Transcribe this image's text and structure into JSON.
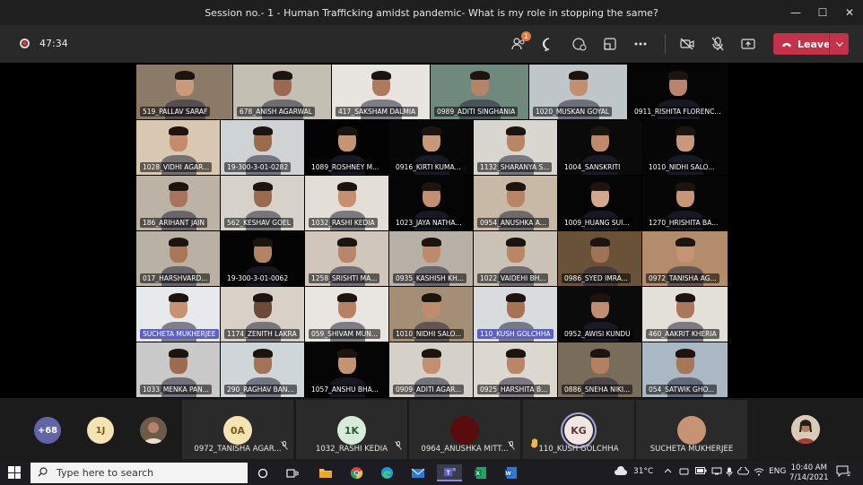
{
  "window": {
    "title": "Session no.- 1 - Human Trafficking amidst pandemic- What is my role in stopping the same?",
    "minimize": "—",
    "maximize": "☐",
    "close": "✕"
  },
  "toolbar": {
    "timer": "47:34",
    "participants_badge": "1",
    "leave_label": "Leave"
  },
  "grid": {
    "tiles": [
      {
        "name": "519_PALLAV SARAF",
        "bg": "#8c7a68",
        "face": "#c99a7a"
      },
      {
        "name": "678_ANISH AGARWAL",
        "bg": "#c4bfb3",
        "face": "#9b6a4e"
      },
      {
        "name": "417_SAKSHAM DALMIA",
        "bg": "#e8e5e0",
        "face": "#b07b5c"
      },
      {
        "name": "0989_ADITI SINGHANIA",
        "bg": "#6f8a7c",
        "face": "#b58468"
      },
      {
        "name": "1020_MUSKAN GOYAL",
        "bg": "#bfc6c9",
        "face": "#c28f70"
      },
      {
        "name": "0911_RISHITA FLORENC...",
        "bg": "#050505",
        "face": "#b9846a"
      },
      {
        "name": "1028_VIDHI AGAR...",
        "bg": "#d8c8b2",
        "face": "#c48c6c"
      },
      {
        "name": "19-300-3-01-0282",
        "bg": "#cfd3d6",
        "face": "#9d6b4c"
      },
      {
        "name": "1089_ROSHNEY M...",
        "bg": "#030303",
        "face": "#c69473"
      },
      {
        "name": "0916_KIRTI KUMA...",
        "bg": "#070707",
        "face": "#c9977a"
      },
      {
        "name": "1132_SHARANYA S...",
        "bg": "#d9d6d0",
        "face": "#b98565"
      },
      {
        "name": "1004_SANSKRITI",
        "bg": "#0a0a0a",
        "face": "#bf8b6b"
      },
      {
        "name": "1010_NIDHI SALO...",
        "bg": "#060606",
        "face": "#c99879"
      },
      {
        "name": "186_ARIHANT JAIN",
        "bg": "#bcb2a5",
        "face": "#a8755a"
      },
      {
        "name": "562_KESHAV GOEL",
        "bg": "#d6d2ca",
        "face": "#9c6b4f"
      },
      {
        "name": "1032_RASHI KEDIA",
        "bg": "#e3ded6",
        "face": "#c49070"
      },
      {
        "name": "1023_JAYA NATHA...",
        "bg": "#050505",
        "face": "#c38f70"
      },
      {
        "name": "0954_ANUSHKA A...",
        "bg": "#c7b9a6",
        "face": "#b88464"
      },
      {
        "name": "1009_HUANG SUI...",
        "bg": "#050505",
        "face": "#d3a98c"
      },
      {
        "name": "1270_HRISHITA BA...",
        "bg": "#060606",
        "face": "#c69676"
      },
      {
        "name": "017_HARSHVARD...",
        "bg": "#b9b1a4",
        "face": "#a97658"
      },
      {
        "name": "19-300-3-01-0062",
        "bg": "#040404",
        "face": "#b48364"
      },
      {
        "name": "1258_SRISHTI MA...",
        "bg": "#d0c6bb",
        "face": "#b8866a"
      },
      {
        "name": "0935_KASHISH KH...",
        "bg": "#b7b0a6",
        "face": "#bd8a6a"
      },
      {
        "name": "1022_VAIDEHI BH...",
        "bg": "#cac2b6",
        "face": "#b98666"
      },
      {
        "name": "0986_SYED IMRA...",
        "bg": "#6a5238",
        "face": "#a17356"
      },
      {
        "name": "0972_TANISHA AG...",
        "bg": "#b38c6c",
        "face": "#c49474"
      },
      {
        "name": "SUCHETA MUKHERJEE",
        "bg": "#e7e9ec",
        "face": "#c69474"
      },
      {
        "name": "1174_ZENITH LAKRA",
        "bg": "#d8d1c7",
        "face": "#6b4a38"
      },
      {
        "name": "059_SHIVAM MUN...",
        "bg": "#e9e6e1",
        "face": "#b78163"
      },
      {
        "name": "1010_NIDHI SALO...",
        "bg": "#a48f76",
        "face": "#bf8c6d"
      },
      {
        "name": "110_KUSH GOLCHHA",
        "bg": "#d9dcdf",
        "face": "#a67455"
      },
      {
        "name": "0952_AWISI KUNDU",
        "bg": "#0b0b0b",
        "face": "#c08e6f"
      },
      {
        "name": "460_AAKRIT KHERIA",
        "bg": "#e3dfd9",
        "face": "#a9785b"
      },
      {
        "name": "1033_MENKA PAN...",
        "bg": "#c9c9c9",
        "face": "#9d6c50"
      },
      {
        "name": "290_RAGHAV BAN...",
        "bg": "#cfd6d9",
        "face": "#a47257"
      },
      {
        "name": "1057_ANSHU BHA...",
        "bg": "#050505",
        "face": "#c49373"
      },
      {
        "name": "0909_ADITI AGAR...",
        "bg": "#d5d0c8",
        "face": "#c28f70"
      },
      {
        "name": "0925_HARSHITA B...",
        "bg": "#ddd8cf",
        "face": "#b98667"
      },
      {
        "name": "0886_SNEHA NIKI...",
        "bg": "#7a6c5a",
        "face": "#b38062"
      },
      {
        "name": "054_SATWIK GHO...",
        "bg": "#a9b8c4",
        "face": "#a87759"
      }
    ]
  },
  "strip": {
    "overflow_count": "+68",
    "chip_1j": "1J",
    "cards": [
      {
        "name": "0972_TANISHA AGAR...",
        "initials": "0A",
        "color": "#f6e3b4",
        "text": "#7a5a1a"
      },
      {
        "name": "1032_RASHI KEDIA",
        "initials": "1K",
        "color": "#d6ecd8",
        "text": "#2e5b34"
      },
      {
        "name": "0964_ANUSHKA MITT...",
        "initials": "",
        "color": "#5a0b0b",
        "text": "#fff"
      },
      {
        "name": "110_KUSH GOLCHHA",
        "initials": "KG",
        "color": "#f1e6e4",
        "text": "#5b3a36"
      },
      {
        "name": "SUCHETA MUKHERJEE",
        "initials": "",
        "color": "#c69474",
        "text": "#fff"
      }
    ]
  },
  "taskbar": {
    "search_placeholder": "Type here to search",
    "weather": "31°C",
    "language": "ENG",
    "time": "10:40 AM",
    "date": "7/14/2021",
    "notifications": "2"
  },
  "colors": {
    "accent": "#5b5fc7",
    "leave": "#c4314b"
  }
}
